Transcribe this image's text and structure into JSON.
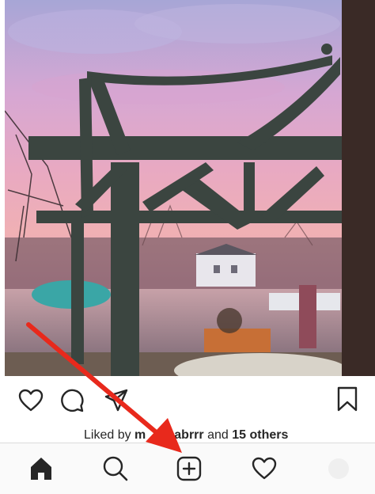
{
  "post": {
    "image_alt": "Sunset over harbor viewed through a pergola",
    "liked_by_prefix": "Liked by ",
    "liked_by_user": "m",
    "liked_by_user_tail": "abrrr",
    "liked_by_and": " and ",
    "liked_by_others": "15 others"
  },
  "icons": {
    "like": "heart-outline-icon",
    "comment": "comment-bubble-icon",
    "share": "paper-plane-icon",
    "save": "bookmark-icon",
    "home": "home-icon",
    "search": "search-icon",
    "new_post": "plus-square-icon",
    "activity": "heart-outline-icon",
    "profile": "avatar-circle"
  },
  "colors": {
    "annotation_arrow": "#e8291c",
    "icon": "#262626",
    "nav_background": "#fafafa"
  }
}
